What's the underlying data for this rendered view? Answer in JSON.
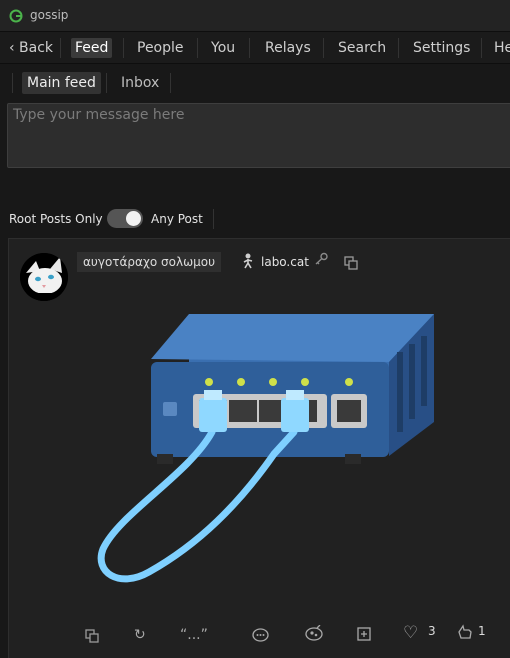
{
  "app": {
    "title": "gossip"
  },
  "nav": {
    "back": "‹ Back",
    "items": [
      "Feed",
      "People",
      "You",
      "Relays",
      "Search",
      "Settings",
      "He"
    ],
    "active": "Feed"
  },
  "subnav": {
    "items": [
      "Main feed",
      "Inbox"
    ],
    "active": "Main feed"
  },
  "composer": {
    "placeholder": "Type your message here",
    "value": ""
  },
  "filter": {
    "left_label": "Root Posts Only",
    "right_label": "Any Post",
    "toggle_on": true
  },
  "post": {
    "author": "αυγοτάραχο σολωμου",
    "nip05": "labo.cat",
    "actions": {
      "quote_label": "“...”",
      "like_count": "3",
      "zap_count": "1"
    }
  },
  "colors": {
    "background": "#181818",
    "panel": "#212121",
    "active_tab": "#3a3a3a",
    "switch_body": "#2f5f9a",
    "cable": "#7fd0ff"
  }
}
